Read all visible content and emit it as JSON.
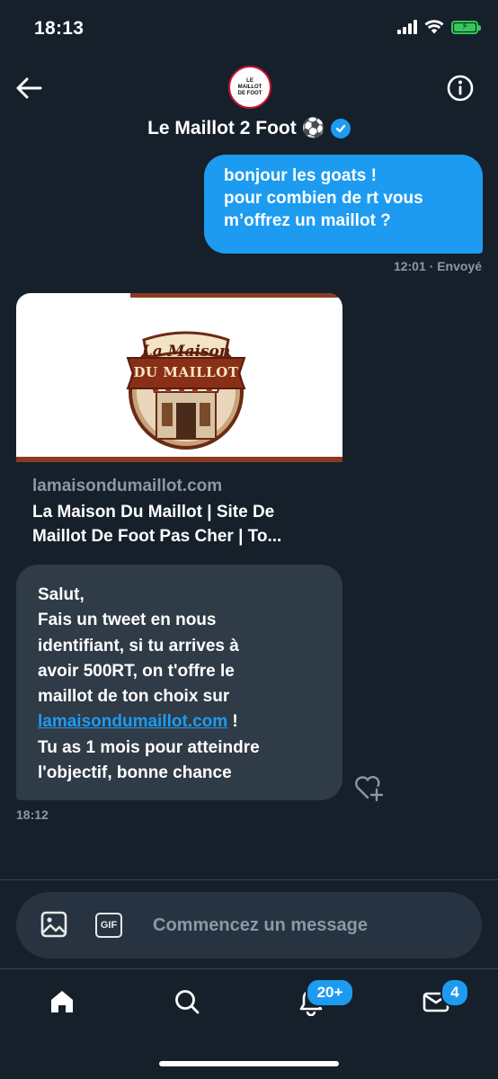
{
  "status_bar": {
    "time": "18:13"
  },
  "header": {
    "avatar_text": [
      "LE",
      "MAILLOT",
      "DE FOOT"
    ],
    "name": "Le Maillot 2 Foot",
    "name_emoji": "⚽"
  },
  "messages": {
    "outgoing": {
      "lines": [
        "bonjour les goats !",
        "pour combien de rt vous",
        "m’offrez un maillot ?"
      ],
      "time": "12:01",
      "status": "· Envoyé"
    },
    "link_card": {
      "logo_text_top": "La Maison",
      "logo_text_banner": "DU MAILLOT",
      "domain": "lamaisondumaillot.com",
      "title_lines": [
        "La Maison Du Maillot | Site De",
        "Maillot De Foot Pas Cher | To..."
      ]
    },
    "incoming": {
      "line1": "Salut,",
      "line2": "Fais un tweet en nous",
      "line3": "identifiant, si tu arrives à",
      "line4": "avoir 500RT, on t'offre le",
      "line5": "maillot de ton choix  sur",
      "link": "lamaisondumaillot.com",
      "link_suffix": " !",
      "line7": "Tu as 1 mois pour atteindre",
      "line8": "l'objectif, bonne chance",
      "time": "18:12"
    }
  },
  "composer": {
    "placeholder": "Commencez un message",
    "gif_label": "GIF"
  },
  "tab_bar": {
    "notifications_badge": "20+",
    "messages_badge": "4"
  },
  "colors": {
    "background": "#15202b",
    "accent": "#1d9bf0",
    "bubble_in": "#2f3b47",
    "battery": "#35c759"
  },
  "icons": [
    "back-arrow-icon",
    "info-icon",
    "verified-icon",
    "heart-plus-icon",
    "image-icon",
    "gif-icon",
    "voice-wave-icon",
    "home-icon",
    "search-icon",
    "bell-icon",
    "mail-icon"
  ]
}
